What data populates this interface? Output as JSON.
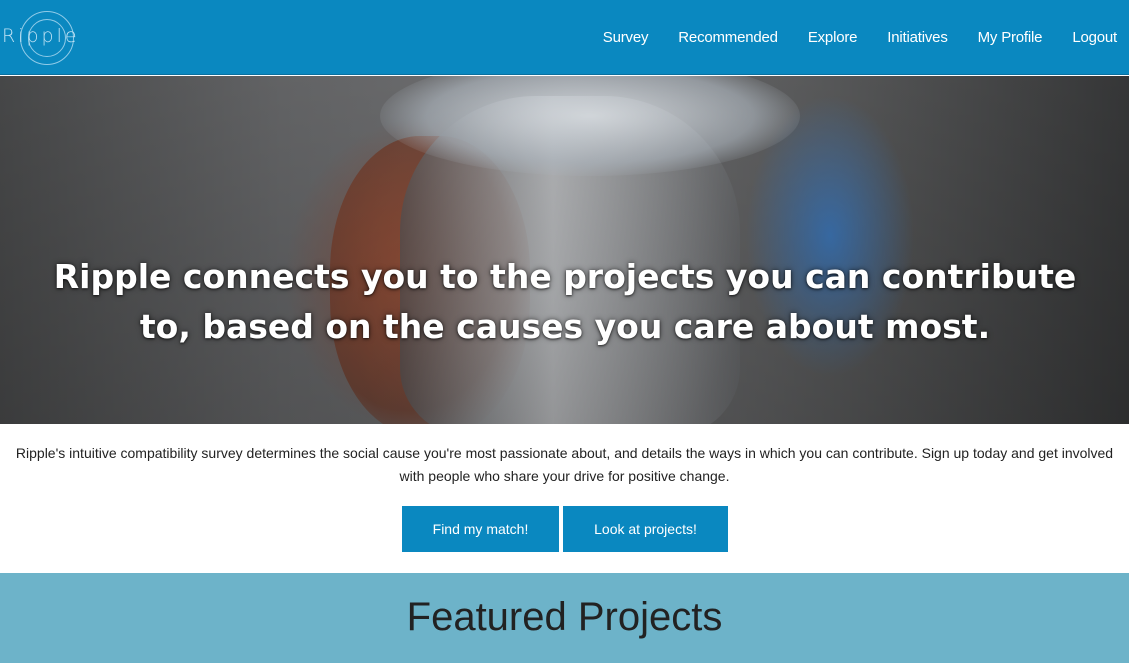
{
  "brand": {
    "logo_text": "Ripple",
    "primary_color": "#0a88c0",
    "featured_bg": "#6db3c9"
  },
  "nav": {
    "items": [
      {
        "label": "Survey"
      },
      {
        "label": "Recommended"
      },
      {
        "label": "Explore"
      },
      {
        "label": "Initiatives"
      },
      {
        "label": "My Profile"
      },
      {
        "label": "Logout"
      }
    ]
  },
  "hero": {
    "heading": "Ripple connects you to the projects you can contribute to, based on the causes you care about most."
  },
  "intro": {
    "text": "Ripple's intuitive compatibility survey determines the social cause you're most passionate about, and details the ways in which you can contribute. Sign up today and get involved with people who share your drive for positive change."
  },
  "actions": {
    "find_match": "Find my match!",
    "look_projects": "Look at projects!"
  },
  "featured": {
    "title": "Featured Projects"
  }
}
